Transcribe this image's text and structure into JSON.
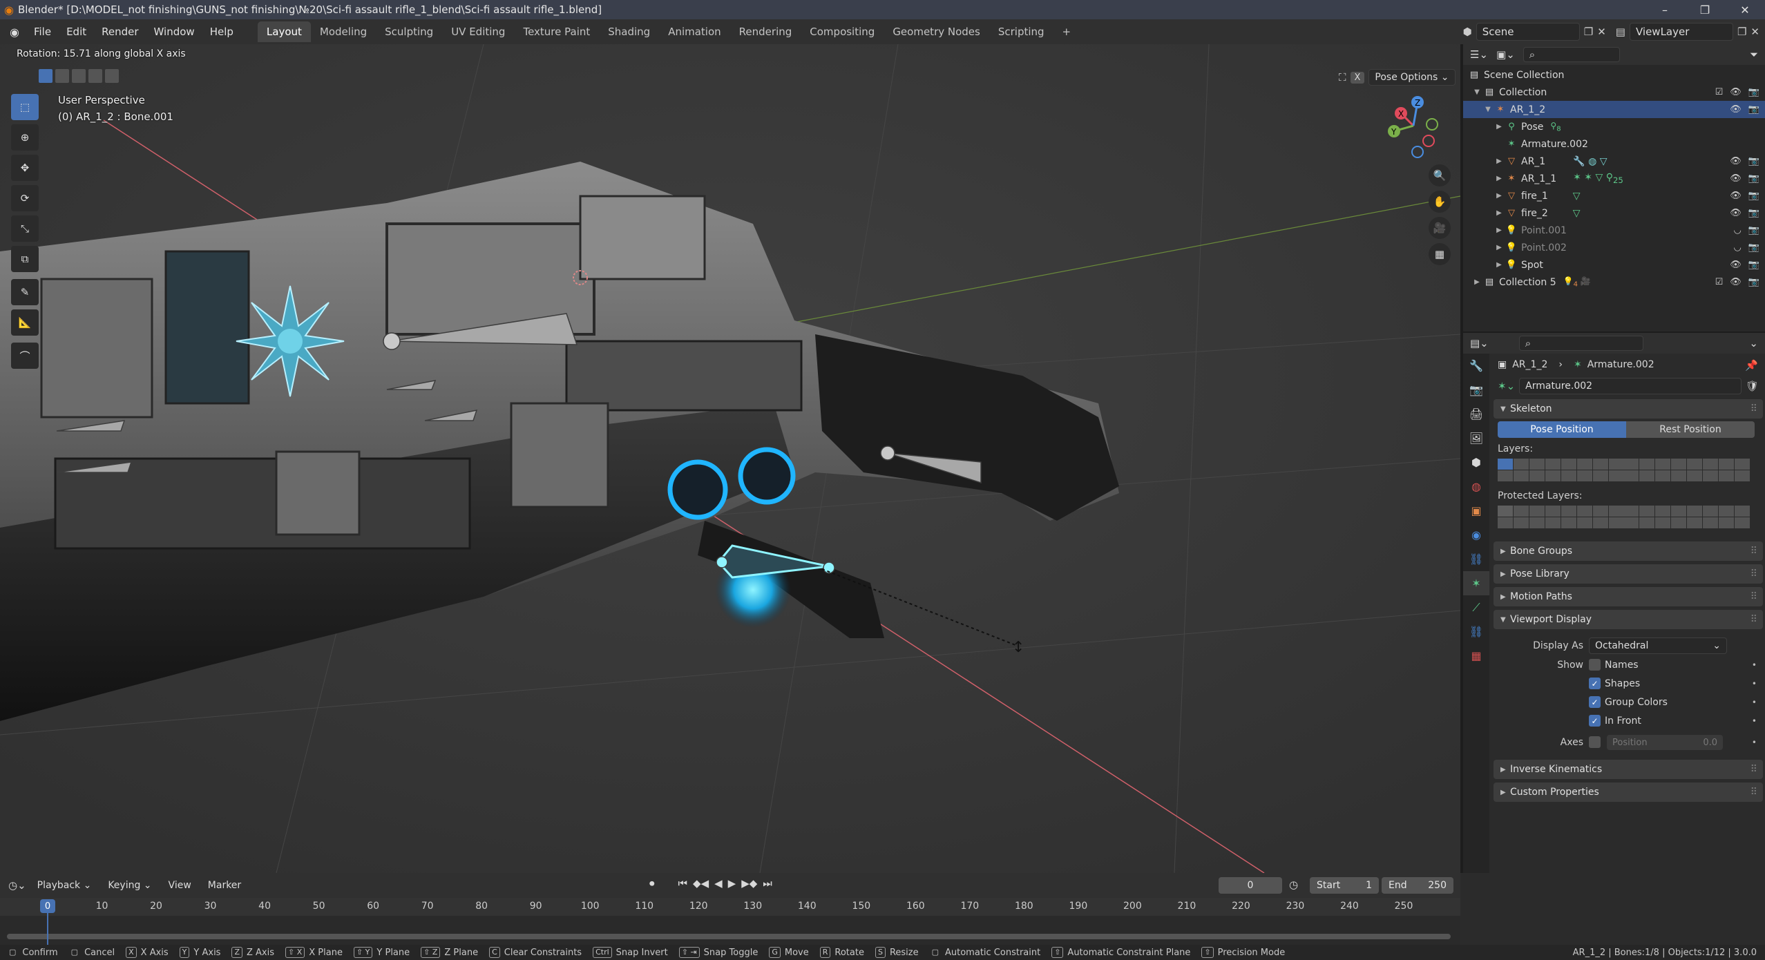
{
  "window": {
    "title": "Blender* [D:\\MODEL_not finishing\\GUNS_not finishing\\№20\\Sci-fi assault rifle_1_blend\\Sci-fi assault rifle_1.blend]",
    "minimize": "–",
    "maximize": "❐",
    "close": "✕"
  },
  "menu": {
    "items": [
      "File",
      "Edit",
      "Render",
      "Window",
      "Help"
    ],
    "workspaces": [
      "Layout",
      "Modeling",
      "Sculpting",
      "UV Editing",
      "Texture Paint",
      "Shading",
      "Animation",
      "Rendering",
      "Compositing",
      "Geometry Nodes",
      "Scripting"
    ],
    "active_workspace": "Layout",
    "add_tab": "+",
    "scene": "Scene",
    "view_layer": "ViewLayer"
  },
  "viewport": {
    "operator_text": "Rotation: 15.71 along global X axis",
    "perspective": "User Perspective",
    "object_info": "(0) AR_1_2 : Bone.001",
    "pose_options": "Pose Options",
    "x_mirror": "X",
    "gizmo_axes": [
      "X",
      "Y",
      "Z"
    ]
  },
  "outliner": {
    "rows": [
      {
        "label": "Scene Collection",
        "icon": "scene-collection-icon",
        "level": 0
      },
      {
        "label": "Collection",
        "icon": "collection-icon",
        "level": 1
      },
      {
        "label": "AR_1_2",
        "icon": "armature-icon",
        "level": 2,
        "selected": true
      },
      {
        "label": "Pose",
        "icon": "pose-icon",
        "level": 3
      },
      {
        "label": "Armature.002",
        "icon": "armature-data-icon",
        "level": 3
      },
      {
        "label": "AR_1",
        "icon": "mesh-icon",
        "level": 2
      },
      {
        "label": "AR_1_1",
        "icon": "armature-icon",
        "level": 2
      },
      {
        "label": "fire_1",
        "icon": "mesh-icon",
        "level": 2
      },
      {
        "label": "fire_2",
        "icon": "mesh-icon",
        "level": 2
      },
      {
        "label": "Point.001",
        "icon": "light-icon",
        "level": 2,
        "dim": true
      },
      {
        "label": "Point.002",
        "icon": "light-icon",
        "level": 2,
        "dim": true
      },
      {
        "label": "Spot",
        "icon": "light-icon",
        "level": 2
      },
      {
        "label": "Collection 5",
        "icon": "collection-icon",
        "level": 1
      }
    ],
    "badge_counts": {
      "pose": "8",
      "ar_1_1": "25",
      "collection_5": "4"
    }
  },
  "properties": {
    "breadcrumb_object": "AR_1_2",
    "breadcrumb_data": "Armature.002",
    "datablock": "Armature.002",
    "skeleton": {
      "title": "Skeleton",
      "pose_position": "Pose Position",
      "rest_position": "Rest Position",
      "layers_label": "Layers:",
      "protected_label": "Protected Layers:"
    },
    "panels": [
      "Bone Groups",
      "Pose Library",
      "Motion Paths",
      "Viewport Display",
      "Inverse Kinematics",
      "Custom Properties"
    ],
    "viewport_display": {
      "display_as_label": "Display As",
      "display_as_value": "Octahedral",
      "show_label": "Show",
      "names": "Names",
      "shapes": "Shapes",
      "group_colors": "Group Colors",
      "in_front": "In Front",
      "axes_label": "Axes",
      "position_label": "Position",
      "position_value": "0.0",
      "checked": {
        "names": false,
        "shapes": true,
        "group_colors": true,
        "in_front": true
      }
    }
  },
  "timeline": {
    "menus": [
      "Playback",
      "Keying",
      "View",
      "Marker"
    ],
    "current_frame": "0",
    "start_label": "Start",
    "start_value": "1",
    "end_label": "End",
    "end_value": "250",
    "ticks": [
      "0",
      "10",
      "20",
      "30",
      "40",
      "50",
      "60",
      "70",
      "80",
      "90",
      "100",
      "110",
      "120",
      "130",
      "140",
      "150",
      "160",
      "170",
      "180",
      "190",
      "200",
      "210",
      "220",
      "230",
      "240",
      "250"
    ]
  },
  "statusbar": {
    "items": [
      {
        "key": "",
        "label": "Confirm"
      },
      {
        "key": "",
        "label": "Cancel"
      },
      {
        "key": "X",
        "label": "X Axis"
      },
      {
        "key": "Y",
        "label": "Y Axis"
      },
      {
        "key": "Z",
        "label": "Z Axis"
      },
      {
        "key": "⇧ X",
        "label": "X Plane"
      },
      {
        "key": "⇧ Y",
        "label": "Y Plane"
      },
      {
        "key": "⇧ Z",
        "label": "Z Plane"
      },
      {
        "key": "C",
        "label": "Clear Constraints"
      },
      {
        "key": "Ctrl",
        "label": "Snap Invert"
      },
      {
        "key": "⇧ ⇥",
        "label": "Snap Toggle"
      },
      {
        "key": "G",
        "label": "Move"
      },
      {
        "key": "R",
        "label": "Rotate"
      },
      {
        "key": "S",
        "label": "Resize"
      },
      {
        "key": "",
        "label": "Automatic Constraint"
      },
      {
        "key": "⇧",
        "label": "Automatic Constraint Plane"
      },
      {
        "key": "⇧",
        "label": "Precision Mode"
      }
    ],
    "stats": "AR_1_2 | Bones:1/8 | Objects:1/12 | 3.0.0"
  }
}
